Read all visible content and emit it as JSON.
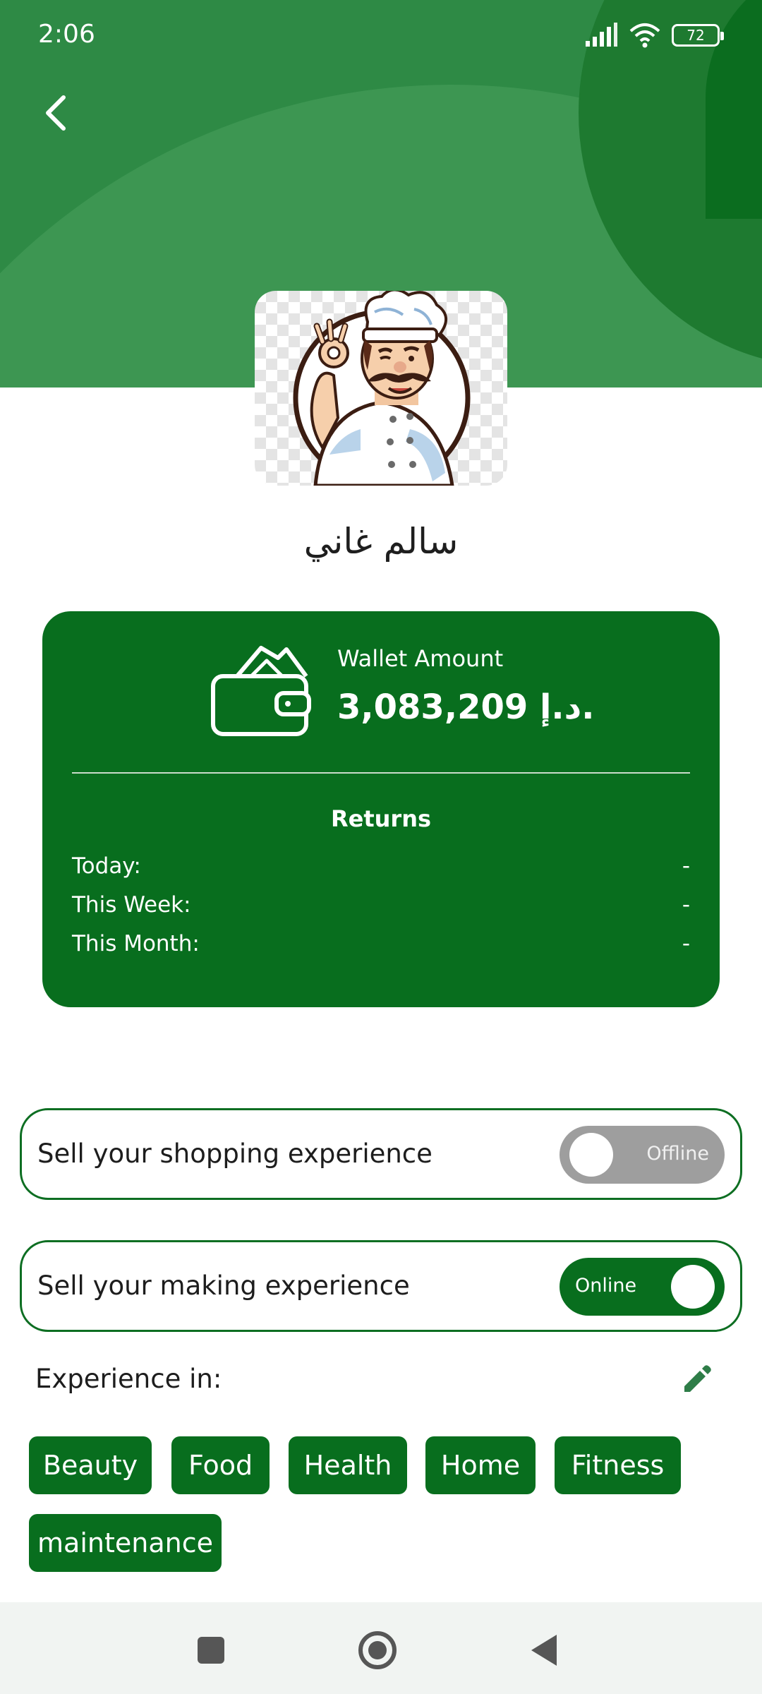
{
  "status_bar": {
    "time": "2:06",
    "battery": "72"
  },
  "header": {
    "back_icon": "chevron-left-icon"
  },
  "profile": {
    "name": "سالم غاني",
    "avatar_icon": "chef-avatar"
  },
  "wallet": {
    "label": "Wallet Amount",
    "amount": "3,083,209 د.إ.",
    "icon": "wallet-icon",
    "returns_title": "Returns",
    "returns": [
      {
        "label": "Today:",
        "value": "-"
      },
      {
        "label": "This Week:",
        "value": "-"
      },
      {
        "label": "This Month:",
        "value": "-"
      }
    ]
  },
  "sell_shopping": {
    "label": "Sell your shopping experience",
    "state": "Offline"
  },
  "sell_making": {
    "label": "Sell your making experience",
    "state": "Online"
  },
  "experience": {
    "label": "Experience in:",
    "edit_icon": "pencil-icon",
    "chips": [
      "Beauty",
      "Food",
      "Health",
      "Home",
      "Fitness",
      "maintenance"
    ]
  },
  "colors": {
    "primary": "#086e1e",
    "header": "#2e8a45",
    "toggle_off": "#9e9e9e"
  }
}
